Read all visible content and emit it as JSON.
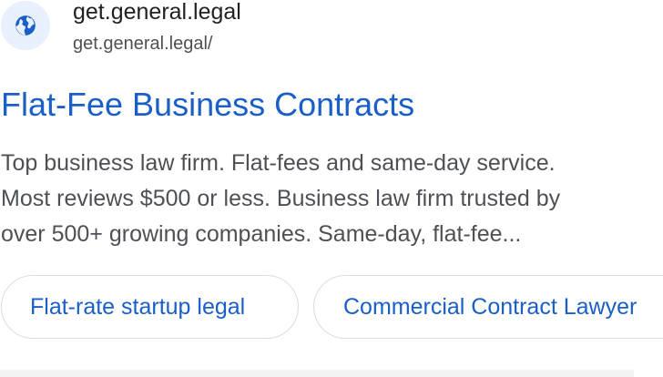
{
  "site": {
    "name": "get.general.legal",
    "url": "get.general.legal/",
    "icon": "globe-icon"
  },
  "result": {
    "title": "Flat-Fee Business Contracts",
    "snippet_lines": [
      "Top business law firm. Flat-fees and same-day service.",
      "Most reviews $500 or less. Business law firm trusted by",
      "over 500+ growing companies. Same-day, flat-fee..."
    ]
  },
  "sitelinks": [
    {
      "label": "Flat-rate startup legal"
    },
    {
      "label": "Commercial Contract Lawyer"
    }
  ],
  "colors": {
    "link": "#1a5fc8",
    "icon_bg": "#e8f0fe",
    "icon_fg": "#1a5fc8"
  }
}
